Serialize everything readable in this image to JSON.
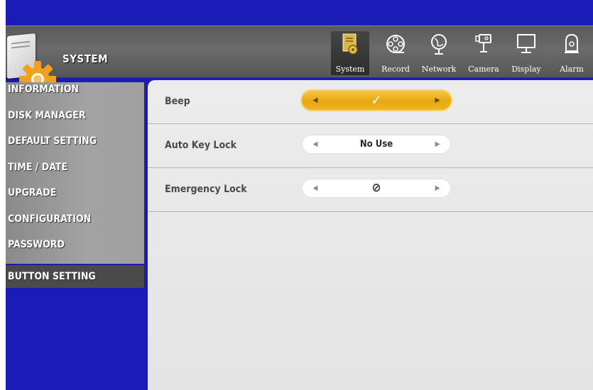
{
  "header": {
    "title": "SYSTEM",
    "tabs": [
      {
        "label": "System",
        "icon": "system-icon",
        "active": true
      },
      {
        "label": "Record",
        "icon": "film-reel-icon"
      },
      {
        "label": "Network",
        "icon": "globe-icon"
      },
      {
        "label": "Camera",
        "icon": "camera-icon"
      },
      {
        "label": "Display",
        "icon": "monitor-icon"
      },
      {
        "label": "Alarm",
        "icon": "alarm-icon"
      }
    ]
  },
  "sidebar": {
    "items": [
      {
        "label": "INFORMATION"
      },
      {
        "label": "DISK MANAGER"
      },
      {
        "label": "DEFAULT SETTING"
      },
      {
        "label": "TIME / DATE"
      },
      {
        "label": "UPGRADE"
      },
      {
        "label": "CONFIGURATION"
      },
      {
        "label": "PASSWORD"
      },
      {
        "label": "BUTTON SETTING",
        "active": true
      }
    ]
  },
  "settings": [
    {
      "label": "Beep",
      "value": "✓",
      "selected": true
    },
    {
      "label": "Auto Key Lock",
      "value": "No Use"
    },
    {
      "label": "Emergency Lock",
      "value": "⊘"
    }
  ],
  "colors": {
    "background": "#1b1bb8",
    "header": "#5e5e5e",
    "sidebar": "#999999",
    "sidebar_active": "#4a4a4a",
    "content": "#e8e8e8",
    "selected_accent": "#f0b525"
  }
}
